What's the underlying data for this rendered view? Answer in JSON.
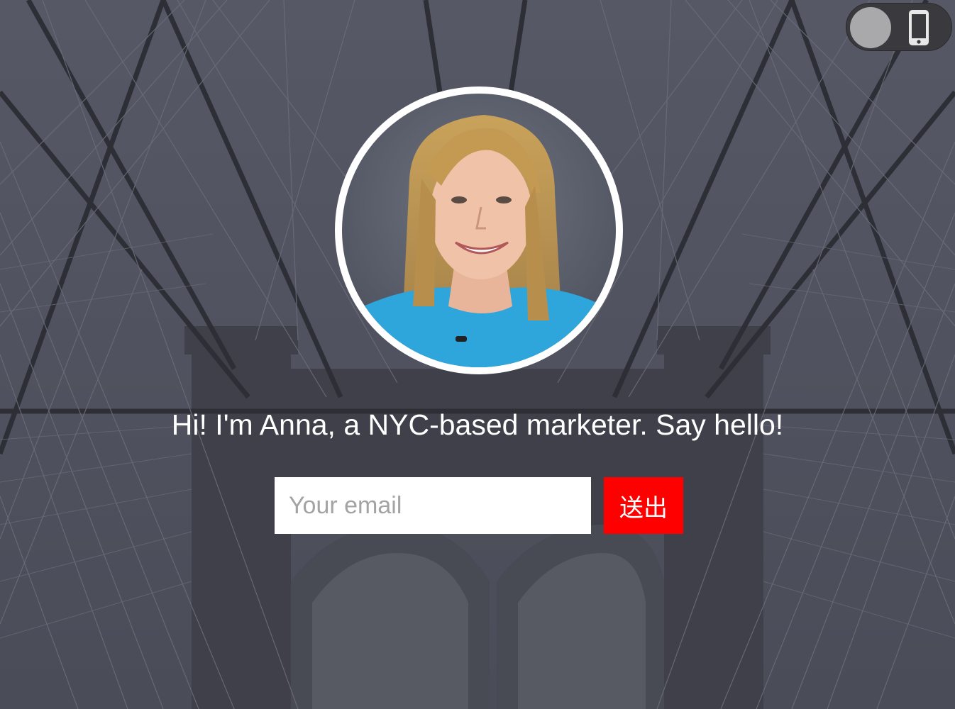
{
  "background": {
    "description_icon": "bridge-background-image",
    "overlay_color": "#4d4f5e"
  },
  "device_toggle": {
    "icon": "mobile-phone-icon",
    "state": "off"
  },
  "profile": {
    "avatar_icon": "profile-photo",
    "tagline": "Hi! I'm Anna, a NYC-based marketer. Say hello!"
  },
  "signup": {
    "email_placeholder": "Your email",
    "email_value": "",
    "submit_label": "送出",
    "submit_color": "#ff0000"
  }
}
